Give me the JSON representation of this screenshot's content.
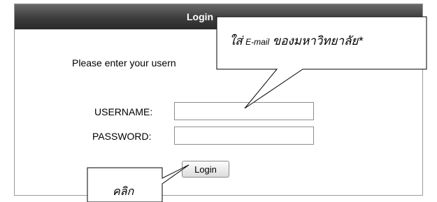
{
  "login_panel": {
    "title": "Login",
    "prompt": "Please enter your usern",
    "username_label": "USERNAME:",
    "username_value": "",
    "password_label": "PASSWORD:",
    "password_value": "",
    "login_button": "Login"
  },
  "callouts": {
    "email_note_prefix": "ใส่",
    "email_note_small": "E-mail",
    "email_note_suffix": "ของมหาวิทยาลัย*",
    "click_note": "คลิก"
  }
}
